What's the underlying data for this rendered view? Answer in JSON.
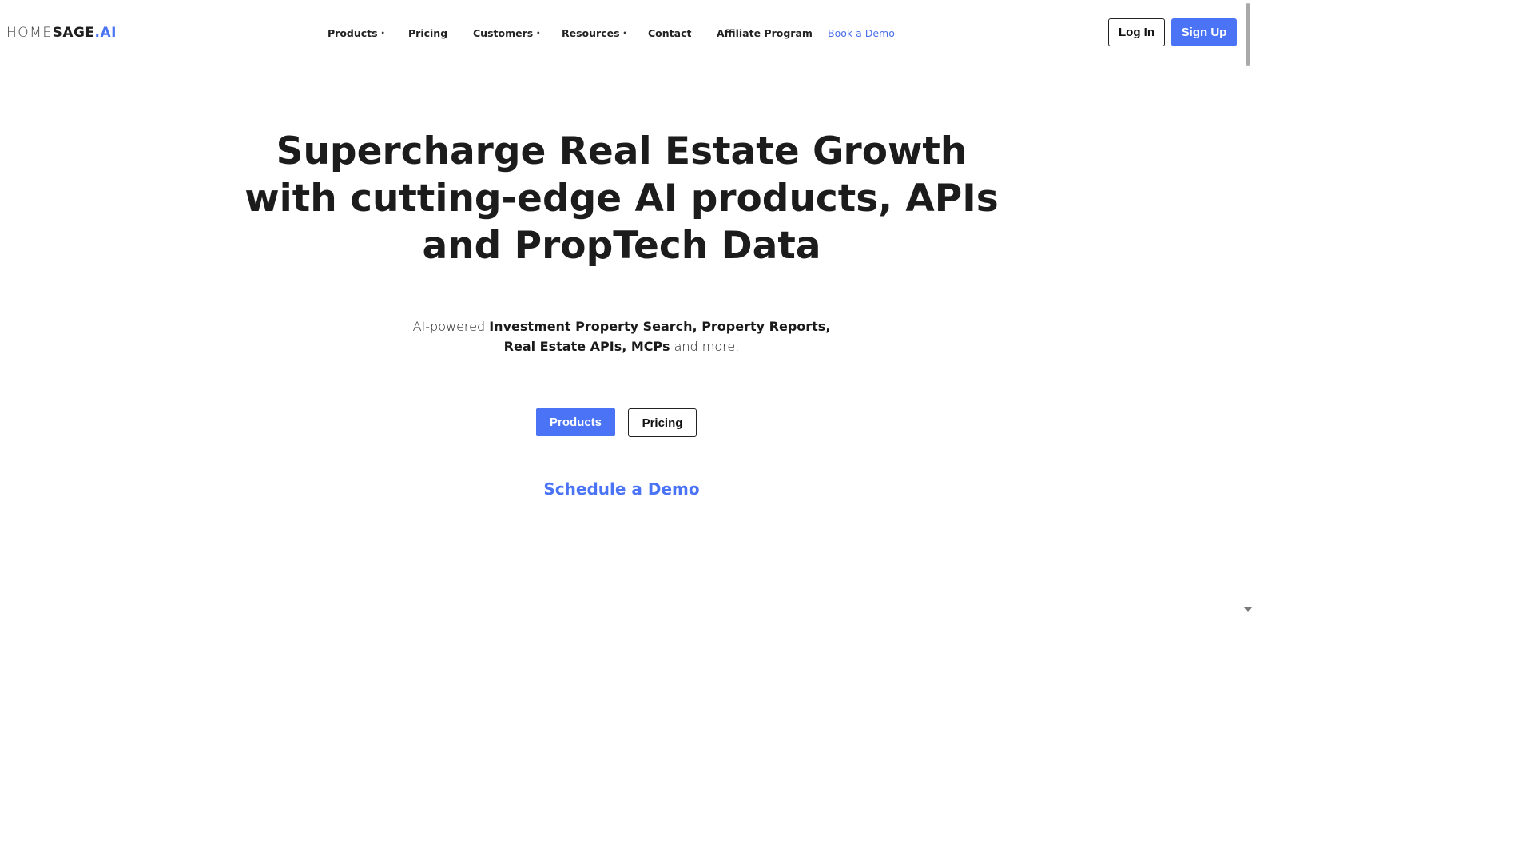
{
  "brand": {
    "logo_home": "HOME",
    "logo_sage": "SAGE",
    "logo_ai": ".AI",
    "accent_color": "#4a74f5"
  },
  "nav": {
    "items": [
      {
        "label": "Products",
        "has_dropdown": true
      },
      {
        "label": "Pricing",
        "has_dropdown": false
      },
      {
        "label": "Customers",
        "has_dropdown": true
      },
      {
        "label": "Resources",
        "has_dropdown": true
      },
      {
        "label": "Contact",
        "has_dropdown": false
      },
      {
        "label": "Affiliate Program",
        "has_dropdown": false
      },
      {
        "label": "Book a Demo",
        "has_dropdown": false
      }
    ],
    "dropdown_marker": "•"
  },
  "auth": {
    "login_label": "Log In",
    "signup_label": "Sign Up"
  },
  "hero": {
    "title_line1": "Supercharge Real Estate Growth",
    "title_line2": "with cutting-edge AI products, APIs",
    "title_line3": "and PropTech Data",
    "sub_prefix": "AI-powered ",
    "sub_bold1": "Investment Property Search, Property Reports,",
    "sub_bold2": "Real Estate APIs, MCPs",
    "sub_suffix": " and more.",
    "products_button": "Products",
    "pricing_button": "Pricing",
    "demo_link": "Schedule a Demo"
  }
}
